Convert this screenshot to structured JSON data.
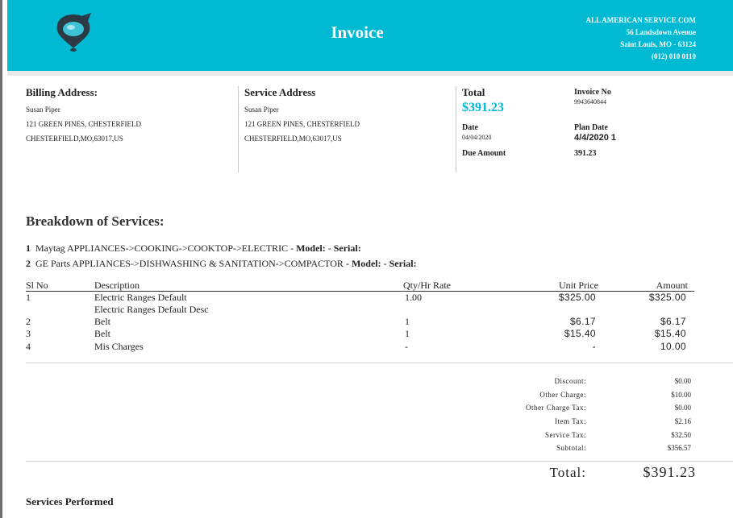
{
  "header": {
    "title": "Invoice",
    "company": [
      "ALL AMERICAN SERVICE COM",
      "56 Landsdown Avenue",
      "Saint Louis, MO - 63124",
      "(012) 010 0110"
    ],
    "brand_color": "#00b9d3",
    "logo_icon": "map-pin-icon"
  },
  "billing": {
    "label": "Billing Address:",
    "name": "Susan Piper",
    "line1": "121 GREEN PINES, CHESTERFIELD",
    "line2": "CHESTERFIELD,MO,63017,US"
  },
  "service_address": {
    "label": "Service Address",
    "name": "Susan Piper",
    "line1": "121 GREEN PINES, CHESTERFIELD",
    "line2": "CHESTERFIELD,MO,63017,US"
  },
  "summary": {
    "total_label": "Total",
    "total_value": "$391.23",
    "invoice_no_label": "Invoice No",
    "invoice_no": "9943640844",
    "date_label": "Date",
    "date": "04/04/2020",
    "plan_date_label": "Plan Date",
    "plan_date": "4/4/2020 1",
    "due_label": "Due Amount",
    "due_value": "391.23"
  },
  "breakdown": {
    "title": "Breakdown of Services:",
    "services": [
      {
        "no": "1",
        "text": "Maytag   APPLIANCES->COOKING->COOKTOP->ELECTRIC - ",
        "model_label": "Model:",
        "sep": " - ",
        "serial_label": "Serial:"
      },
      {
        "no": "2",
        "text": "GE Parts   APPLIANCES->DISHWASHING & SANITATION->COMPACTOR - ",
        "model_label": "Model:",
        "sep": " - ",
        "serial_label": "Serial:"
      }
    ]
  },
  "table": {
    "headers": {
      "sl": "Sl No",
      "desc": "Description",
      "qty": "Qty/Hr Rate",
      "unit": "Unit Price",
      "amount": "Amount"
    },
    "rows": [
      {
        "sl": "1",
        "desc": "Electric Ranges Default",
        "qty": "1.00",
        "unit": "$325.00",
        "amount": "$325.00"
      },
      {
        "sl": "",
        "desc": "Electric Ranges Default Desc",
        "qty": "",
        "unit": "",
        "amount": ""
      },
      {
        "sl": "2",
        "desc": "Belt",
        "qty": "1",
        "unit": "$6.17",
        "amount": "$6.17"
      },
      {
        "sl": "3",
        "desc": "Belt",
        "qty": "1",
        "unit": "$15.40",
        "amount": "$15.40"
      },
      {
        "sl": "4",
        "desc": "Mis Charges",
        "qty": "-",
        "unit": "-",
        "amount": "10.00"
      }
    ]
  },
  "totals": {
    "discount_label": "Discount:",
    "discount": "$0.00",
    "other_charge_label": "Other Charge:",
    "other_charge": "$10.00",
    "other_charge_tax_label": "Other Charge Tax:",
    "other_charge_tax": "$0.00",
    "item_tax_label": "Item Tax:",
    "item_tax": "$2.16",
    "service_tax_label": "Service Tax:",
    "service_tax": "$32.50",
    "subtotal_label": "Subtotal:",
    "subtotal": "$356.57",
    "total_label": "Total:",
    "total": "$391.23"
  },
  "services_performed": {
    "title": "Services Performed"
  }
}
